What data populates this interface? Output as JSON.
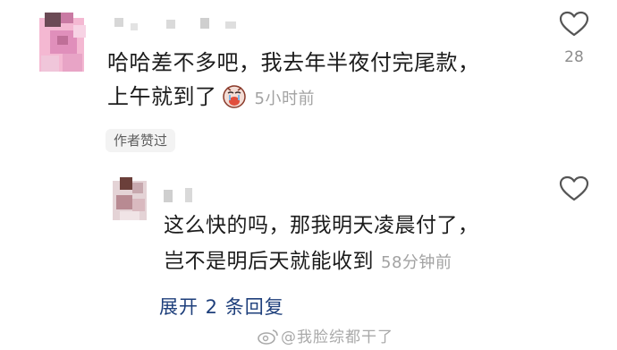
{
  "comment": {
    "text_line1": "哈哈差不多吧，我去年半夜付完尾款，",
    "text_line2": "上午就到了",
    "emoji": "crying-face-emoji",
    "time": "5小时前",
    "like_count": "28",
    "badge": "作者赞过"
  },
  "reply": {
    "text_line1": "这么快的吗，那我明天凌晨付了，",
    "text_line2": "岂不是明后天就能收到",
    "time": "58分钟前"
  },
  "expand_replies": "展开 2 条回复",
  "watermark": "@我脸综都干了",
  "icons": {
    "like": "heart-outline-icon",
    "watermark_logo": "weibo-logo-icon"
  },
  "colors": {
    "link": "#1e3f7b",
    "muted": "#a2a2a2",
    "badge_bg": "#f3f3f3"
  }
}
